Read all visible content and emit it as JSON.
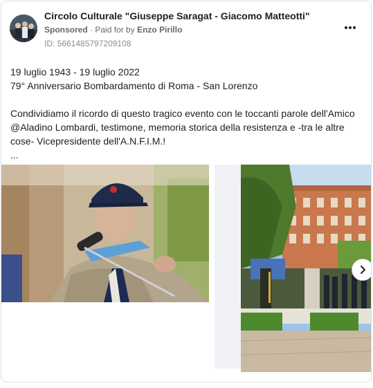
{
  "post": {
    "page_name": "Circolo Culturale \"Giuseppe Saragat - Giacomo Matteotti\"",
    "sponsored": "Sponsored",
    "paid_for_prefix": "Paid for by",
    "payer": "Enzo Pirillo",
    "ad_id": "ID: 5661485797209108",
    "body_lines": [
      "19 luglio 1943 - 19 luglio 2022",
      "79° Anniversario Bombardamento di Roma - San Lorenzo",
      "",
      "Condividiamo il ricordo di questo tragico evento con le toccanti parole dell'Amico",
      "@Aladino Lombardi, testimone, memoria storica della resistenza e -tra le altre",
      "cose- Vicepresidente dell'A.N.F.I.M.!",
      "..."
    ]
  },
  "icons": {
    "more": "more-options-icon",
    "next": "chevron-right-icon"
  },
  "colors": {
    "text": "#1c1e21",
    "secondary": "#65676b",
    "muted": "#8a8d91",
    "border": "#dddfe2"
  }
}
